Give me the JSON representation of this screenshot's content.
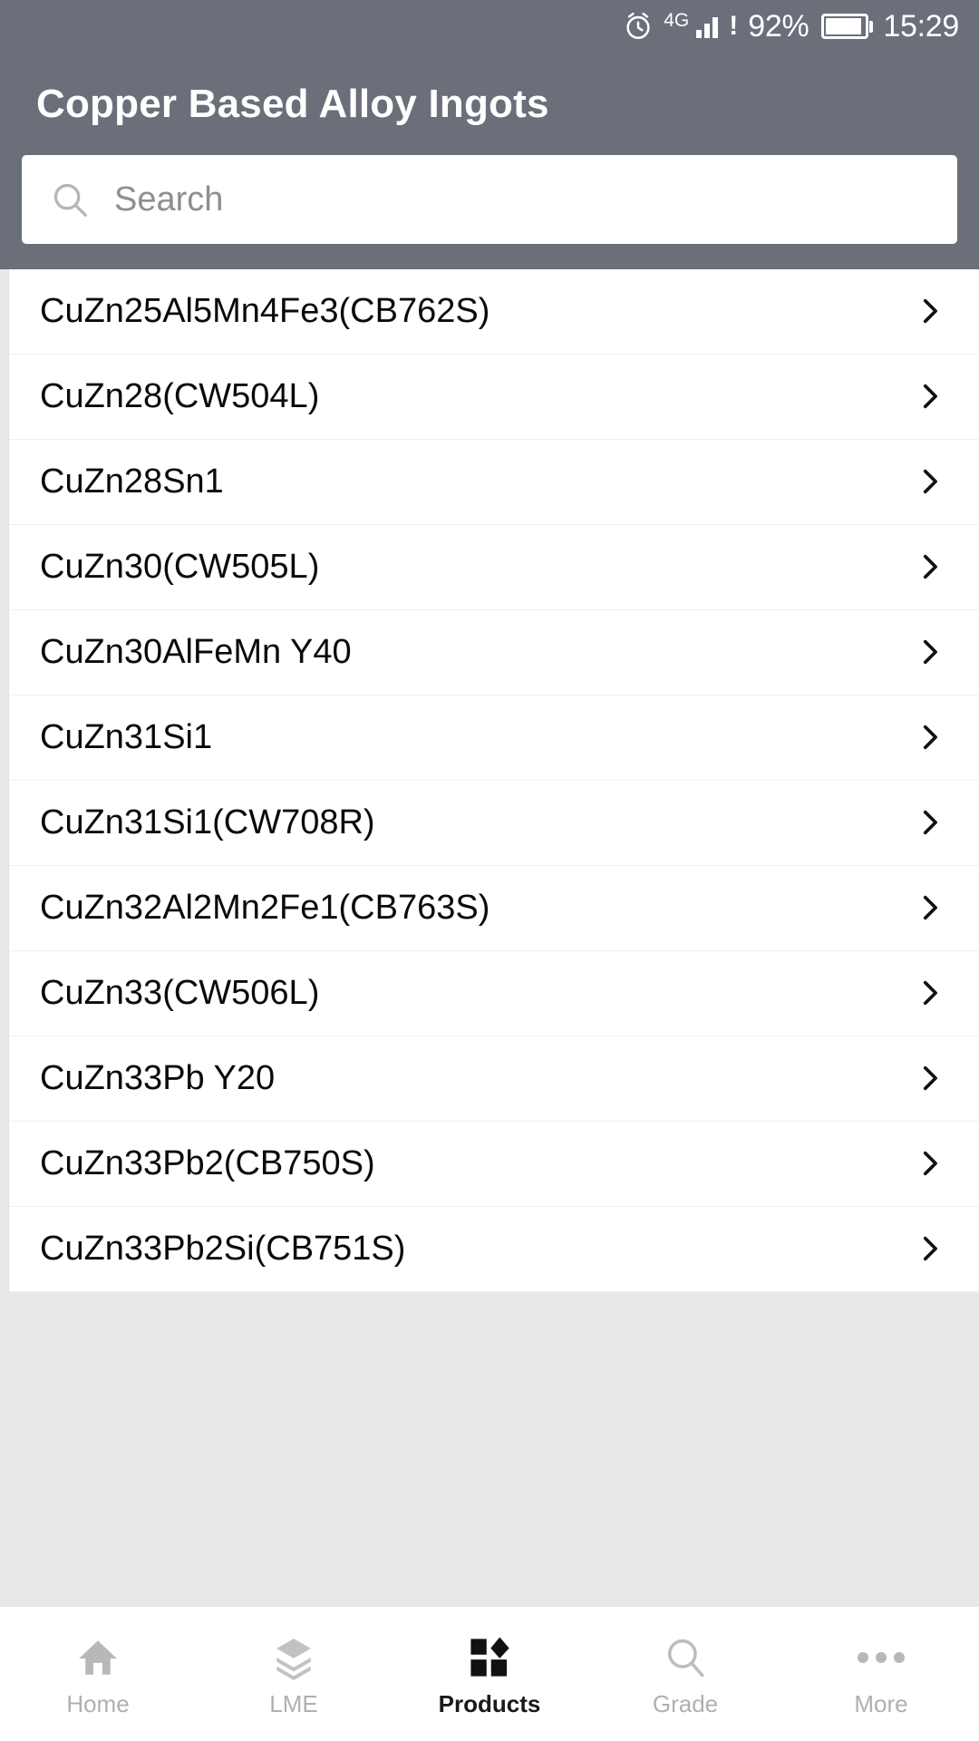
{
  "status_bar": {
    "alarm_icon": "alarm-clock-icon",
    "network_type": "4G",
    "signal_icon": "signal-bars-icon",
    "sim_alert": "!",
    "battery_percent": "92%",
    "battery_icon": "battery-icon",
    "time": "15:29"
  },
  "header": {
    "title": "Copper Based Alloy Ingots",
    "background_color": "#6b6f7a",
    "text_color": "#ffffff"
  },
  "search": {
    "icon": "search-icon",
    "placeholder": "Search",
    "value": ""
  },
  "list": {
    "chevron_icon": "chevron-right-icon",
    "items": [
      {
        "label": "CuZn25Al5Mn4Fe3(CB762S)"
      },
      {
        "label": "CuZn28(CW504L)"
      },
      {
        "label": "CuZn28Sn1"
      },
      {
        "label": "CuZn30(CW505L)"
      },
      {
        "label": "CuZn30AlFeMn Y40"
      },
      {
        "label": "CuZn31Si1"
      },
      {
        "label": "CuZn31Si1(CW708R)"
      },
      {
        "label": "CuZn32Al2Mn2Fe1(CB763S)"
      },
      {
        "label": "CuZn33(CW506L)"
      },
      {
        "label": "CuZn33Pb Y20"
      },
      {
        "label": "CuZn33Pb2(CB750S)"
      },
      {
        "label": "CuZn33Pb2Si(CB751S)"
      }
    ]
  },
  "bottom_nav": {
    "active_index": 2,
    "active_color": "#1a1a1a",
    "inactive_color": "#b0b0b0",
    "items": [
      {
        "label": "Home",
        "icon": "home-icon"
      },
      {
        "label": "LME",
        "icon": "layers-icon"
      },
      {
        "label": "Products",
        "icon": "grid-products-icon"
      },
      {
        "label": "Grade",
        "icon": "search-icon"
      },
      {
        "label": "More",
        "icon": "ellipsis-icon"
      }
    ]
  }
}
